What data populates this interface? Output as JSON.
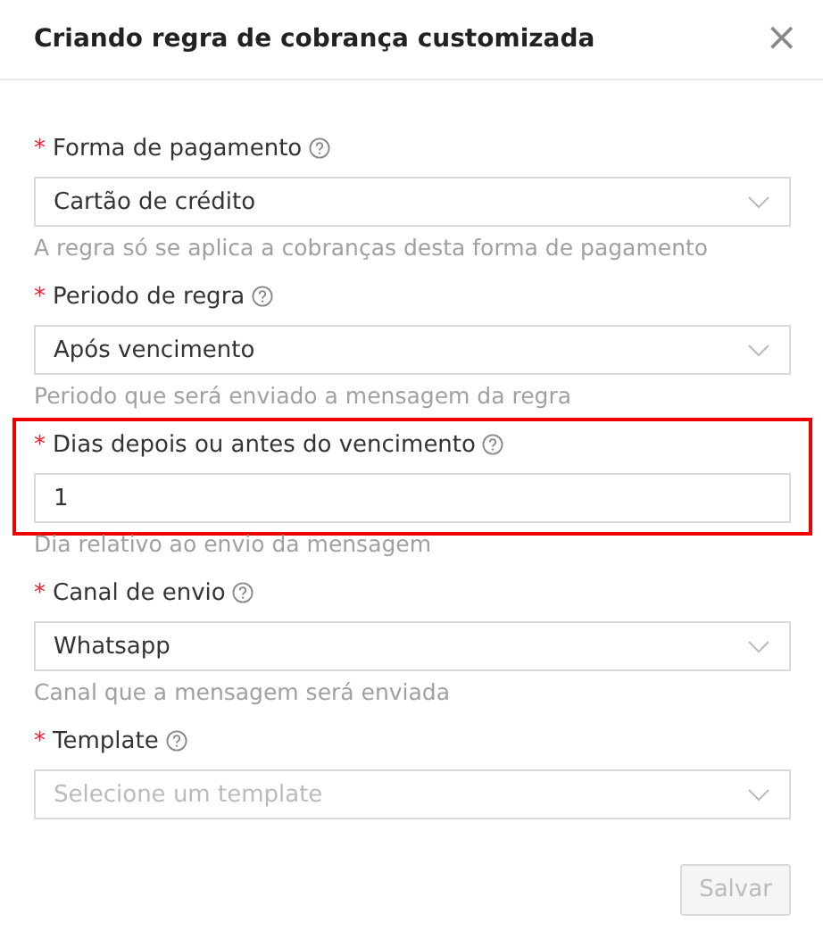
{
  "dialog": {
    "title": "Criando regra de cobrança customizada",
    "close": "×"
  },
  "fields": [
    {
      "kind": "select",
      "required_mark": "*",
      "label": "Forma de pagamento",
      "value": "Cartão de crédito",
      "help": "A regra só se aplica a cobranças desta forma de pagamento",
      "highlighted": false
    },
    {
      "kind": "select",
      "required_mark": "*",
      "label": "Periodo de regra",
      "value": "Após vencimento",
      "help": "Periodo que será enviado a mensagem da regra",
      "highlighted": false
    },
    {
      "kind": "input",
      "required_mark": "*",
      "label": "Dias depois ou antes do vencimento",
      "value": "1",
      "help": "Dia relativo ao envio da mensagem",
      "highlighted": true
    },
    {
      "kind": "select",
      "required_mark": "*",
      "label": "Canal de envio",
      "value": "Whatsapp",
      "help": "Canal que a mensagem será enviada",
      "highlighted": false
    },
    {
      "kind": "select",
      "required_mark": "*",
      "label": "Template",
      "placeholder": "Selecione um template",
      "highlighted": false
    }
  ],
  "save_button": {
    "label": "Salvar",
    "disabled": true
  }
}
